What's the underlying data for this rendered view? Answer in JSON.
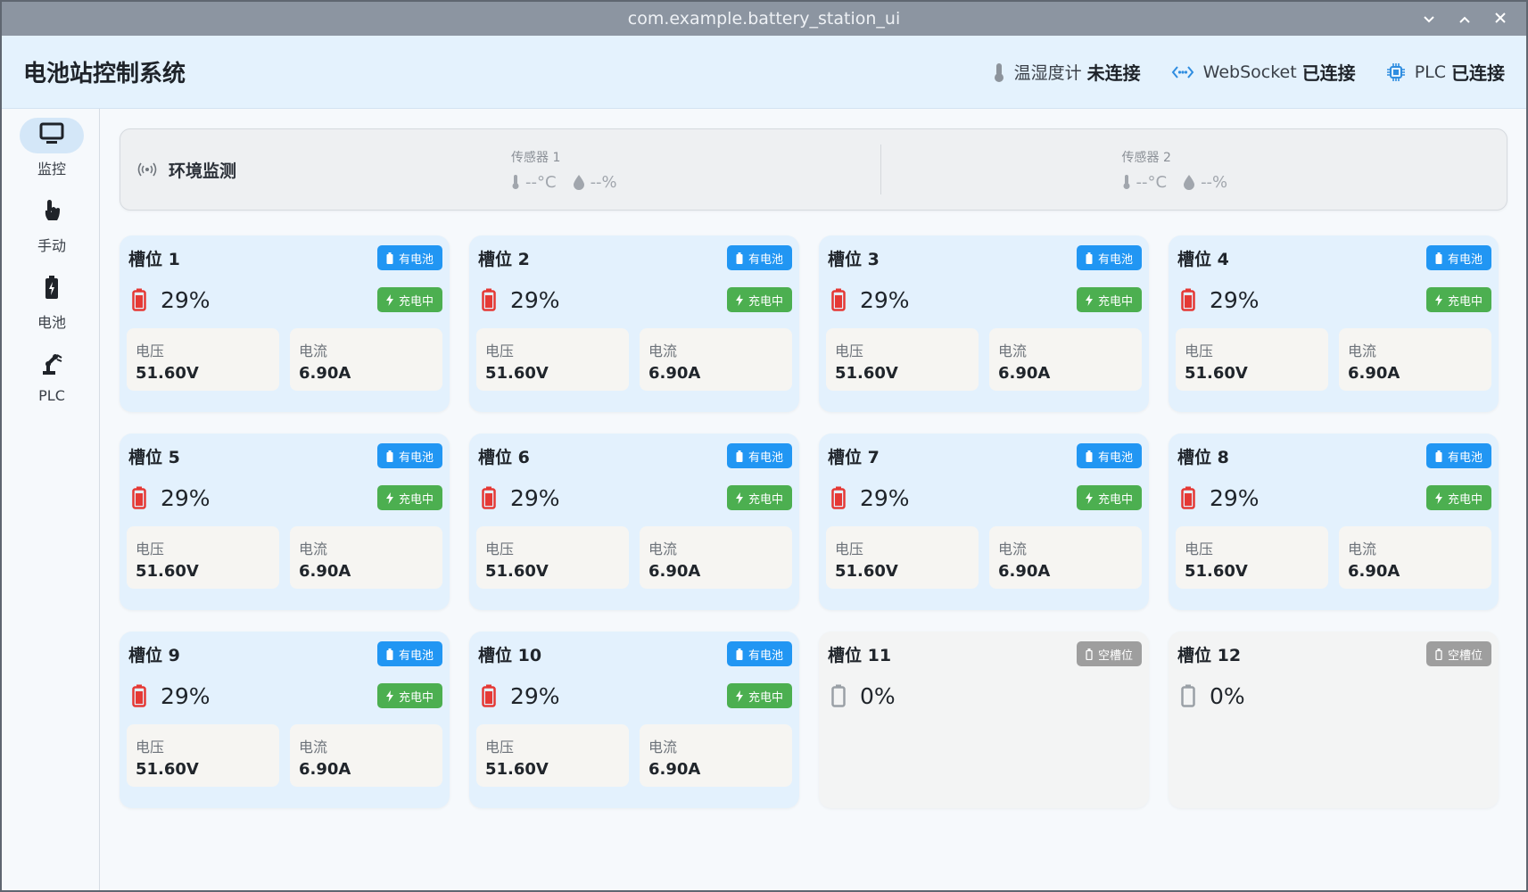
{
  "window": {
    "title": "com.example.battery_station_ui"
  },
  "header": {
    "title": "电池站控制系统",
    "statuses": [
      {
        "label": "温湿度计",
        "value": "未连接"
      },
      {
        "label": "WebSocket",
        "value": "已连接"
      },
      {
        "label": "PLC",
        "value": "已连接"
      }
    ]
  },
  "nav": [
    {
      "label": "监控",
      "icon": "monitor-icon",
      "active": true
    },
    {
      "label": "手动",
      "icon": "hand-pointer-icon",
      "active": false
    },
    {
      "label": "电池",
      "icon": "battery-charging-icon",
      "active": false
    },
    {
      "label": "PLC",
      "icon": "robot-arm-icon",
      "active": false
    }
  ],
  "env": {
    "title": "环境监测",
    "sensors": [
      {
        "name": "传感器 1",
        "temp": "--°C",
        "humidity": "--%"
      },
      {
        "name": "传感器 2",
        "temp": "--°C",
        "humidity": "--%"
      }
    ]
  },
  "labels": {
    "voltage": "电压",
    "current": "电流"
  },
  "slots": [
    {
      "name": "槽位 1",
      "status": "有电池",
      "charge": "充电中",
      "percent": "29%",
      "voltage": "51.60V",
      "current": "6.90A",
      "has_battery": true
    },
    {
      "name": "槽位 2",
      "status": "有电池",
      "charge": "充电中",
      "percent": "29%",
      "voltage": "51.60V",
      "current": "6.90A",
      "has_battery": true
    },
    {
      "name": "槽位 3",
      "status": "有电池",
      "charge": "充电中",
      "percent": "29%",
      "voltage": "51.60V",
      "current": "6.90A",
      "has_battery": true
    },
    {
      "name": "槽位 4",
      "status": "有电池",
      "charge": "充电中",
      "percent": "29%",
      "voltage": "51.60V",
      "current": "6.90A",
      "has_battery": true
    },
    {
      "name": "槽位 5",
      "status": "有电池",
      "charge": "充电中",
      "percent": "29%",
      "voltage": "51.60V",
      "current": "6.90A",
      "has_battery": true
    },
    {
      "name": "槽位 6",
      "status": "有电池",
      "charge": "充电中",
      "percent": "29%",
      "voltage": "51.60V",
      "current": "6.90A",
      "has_battery": true
    },
    {
      "name": "槽位 7",
      "status": "有电池",
      "charge": "充电中",
      "percent": "29%",
      "voltage": "51.60V",
      "current": "6.90A",
      "has_battery": true
    },
    {
      "name": "槽位 8",
      "status": "有电池",
      "charge": "充电中",
      "percent": "29%",
      "voltage": "51.60V",
      "current": "6.90A",
      "has_battery": true
    },
    {
      "name": "槽位 9",
      "status": "有电池",
      "charge": "充电中",
      "percent": "29%",
      "voltage": "51.60V",
      "current": "6.90A",
      "has_battery": true
    },
    {
      "name": "槽位 10",
      "status": "有电池",
      "charge": "充电中",
      "percent": "29%",
      "voltage": "51.60V",
      "current": "6.90A",
      "has_battery": true
    },
    {
      "name": "槽位 11",
      "status": "空槽位",
      "percent": "0%",
      "has_battery": false
    },
    {
      "name": "槽位 12",
      "status": "空槽位",
      "percent": "0%",
      "has_battery": false
    }
  ],
  "colors": {
    "accent": "#2196f3",
    "charging": "#4caf50",
    "empty": "#9e9e9e",
    "battery_low": "#e53935"
  }
}
